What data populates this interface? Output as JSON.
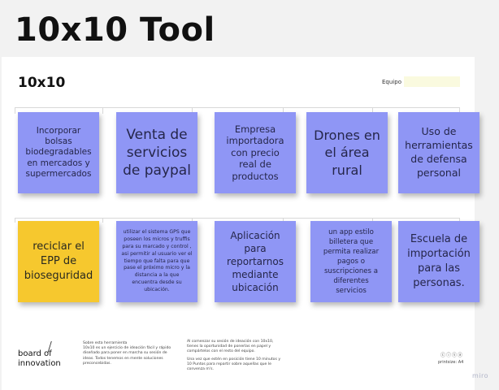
{
  "page": {
    "title": "10x10 Tool"
  },
  "board": {
    "title": "10x10",
    "team_label": "Equipo",
    "row1": [
      {
        "text": "Incorporar bolsas biodegradables en mercados y supermercados",
        "color": "#8f96f5"
      },
      {
        "text": "Venta de servicios de paypal",
        "color": "#8f96f5"
      },
      {
        "text": "Empresa importadora con precio real de productos",
        "color": "#8f96f5"
      },
      {
        "text": "Drones en el área rural",
        "color": "#8f96f5"
      },
      {
        "text": "Uso de herramientas de defensa personal",
        "color": "#8f96f5"
      }
    ],
    "row2": [
      {
        "text": "reciclar el EPP de bioseguridad",
        "color": "#f6c82e"
      },
      {
        "text": "utilizar el sistema GPS que poseen los micros y truffis para su marcado y control , asi permitir al usuario ver el tiempo que falta para que pase el próximo micro y la distancia a la que encuentra desde su ubicación.",
        "color": "#8f96f5"
      },
      {
        "text": "Aplicación para reportarnos mediante ubicación",
        "color": "#8f96f5"
      },
      {
        "text": "un app estilo billetera que permita realizar pagos o suscripciones a diferentes servicios",
        "color": "#8f96f5"
      },
      {
        "text": "Escuela de importación para las personas.",
        "color": "#8f96f5"
      }
    ]
  },
  "footer": {
    "logo_line1": "board of",
    "logo_line2": "innovation",
    "col1": "Sobre esta herramienta\n10x10 es un ejercicio de ideación fácil y rápido diseñado para poner en marcha su sesión de ideas. Todos tenemos en mente soluciones preconcebidas.",
    "col2a": "Al comenzar su sesión de ideación con 10x10, tienes la oportunidad de ponerlas en papel y compártelos con el resto del equipo.",
    "col2b": "Una vez que estén en posición tiene 10 minutos y 10 Puntos para repartir sobre aquellas que le convenza m's.",
    "license_icons": "ⓒⓘⓢⓐ",
    "printsize": "printsize: A4",
    "brand": "miro"
  }
}
